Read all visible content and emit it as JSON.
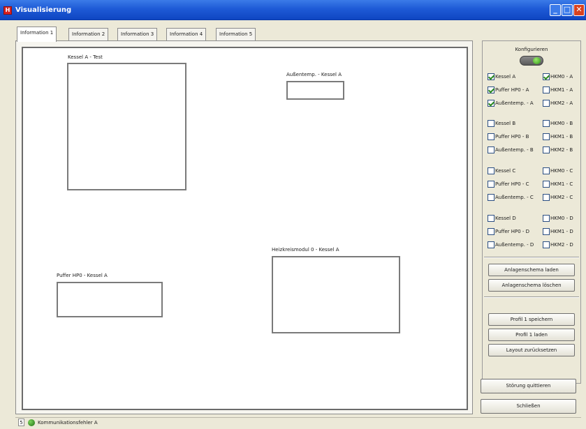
{
  "window": {
    "title": "Visualisierung",
    "icon_glyph": "H",
    "minimize_icon": "minimize-icon",
    "maximize_icon": "maximize-icon",
    "close_icon": "close-icon",
    "min_glyph": "_",
    "max_glyph": "□",
    "close_glyph": "✕"
  },
  "tabs": [
    {
      "label": "Information 1",
      "active": true
    },
    {
      "label": "Information 2",
      "active": false
    },
    {
      "label": "Information 3",
      "active": false
    },
    {
      "label": "Information 4",
      "active": false
    },
    {
      "label": "Information 5",
      "active": false
    }
  ],
  "widgets": [
    {
      "label": "Kessel A - Test"
    },
    {
      "label": "Außentemp. - Kessel A"
    },
    {
      "label": "Heizkreismodul 0 - Kessel A"
    },
    {
      "label": "Puffer HP0 - Kessel A"
    }
  ],
  "config_panel": {
    "title": "Konfigurieren",
    "toggle_on": true,
    "checkbox_groups": [
      {
        "left": [
          {
            "label": "Kessel A",
            "checked": true
          },
          {
            "label": "Puffer HP0 - A",
            "checked": true
          },
          {
            "label": "Außentemp. - A",
            "checked": true
          }
        ],
        "right": [
          {
            "label": "HKM0 - A",
            "checked": true
          },
          {
            "label": "HKM1 - A",
            "checked": false
          },
          {
            "label": "HKM2 - A",
            "checked": false
          }
        ]
      },
      {
        "left": [
          {
            "label": "Kessel B",
            "checked": false
          },
          {
            "label": "Puffer HP0 - B",
            "checked": false
          },
          {
            "label": "Außentemp. - B",
            "checked": false
          }
        ],
        "right": [
          {
            "label": "HKM0 - B",
            "checked": false
          },
          {
            "label": "HKM1 - B",
            "checked": false
          },
          {
            "label": "HKM2 - B",
            "checked": false
          }
        ]
      },
      {
        "left": [
          {
            "label": "Kessel C",
            "checked": false
          },
          {
            "label": "Puffer HP0 - C",
            "checked": false
          },
          {
            "label": "Außentemp. - C",
            "checked": false
          }
        ],
        "right": [
          {
            "label": "HKM0 - C",
            "checked": false
          },
          {
            "label": "HKM1 - C",
            "checked": false
          },
          {
            "label": "HKM2 - C",
            "checked": false
          }
        ]
      },
      {
        "left": [
          {
            "label": "Kessel D",
            "checked": false
          },
          {
            "label": "Puffer HP0 - D",
            "checked": false
          },
          {
            "label": "Außentemp. - D",
            "checked": false
          }
        ],
        "right": [
          {
            "label": "HKM0 - D",
            "checked": false
          },
          {
            "label": "HKM1 - D",
            "checked": false
          },
          {
            "label": "HKM2 - D",
            "checked": false
          }
        ]
      }
    ],
    "buttons": {
      "load_scheme": "Anlagenschema laden",
      "delete_scheme": "Anlagenschema löschen",
      "save_profile": "Profil 1 speichern",
      "load_profile": "Profil 1 laden",
      "reset_layout": "Layout zurücksetzen"
    }
  },
  "actions": {
    "acknowledge": "Störung quittieren",
    "close": "Schließen"
  },
  "statusbar": {
    "id": "5",
    "led_icon": "status-led-icon",
    "text": "Kommunikationsfehler A"
  }
}
